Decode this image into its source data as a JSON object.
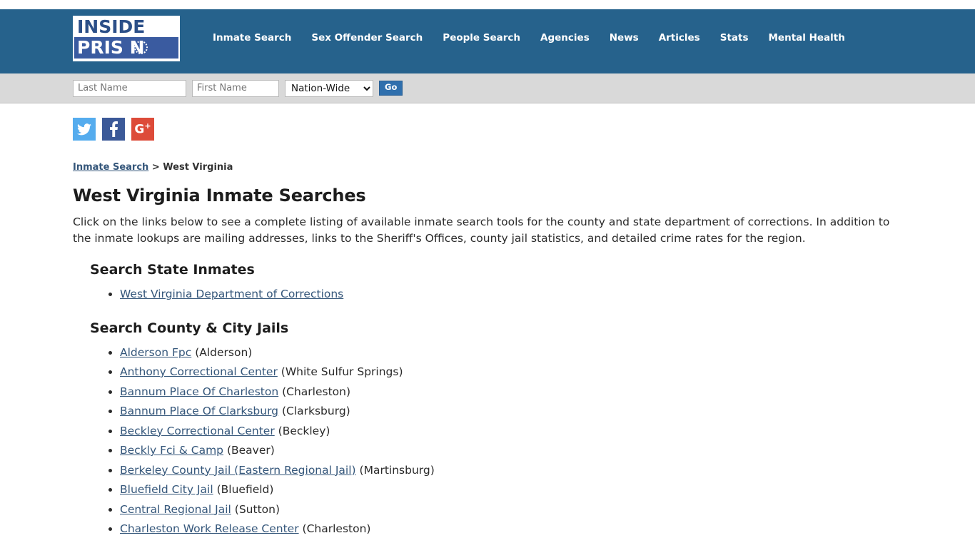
{
  "brand": {
    "logo_line1": "INSIDE",
    "logo_line2": "PRIS N",
    "ring_icon": "barbed-wire-circle-icon"
  },
  "colors": {
    "header_blue": "#26628c",
    "searchbar_gray": "#d9d9d9",
    "link_blue": "#34567a",
    "go_button_blue": "#2f6fad",
    "twitter": "#55acee",
    "facebook": "#3b5998",
    "googleplus": "#dd4b39"
  },
  "nav": {
    "items": [
      {
        "label": "Inmate Search"
      },
      {
        "label": "Sex Offender Search"
      },
      {
        "label": "People Search"
      },
      {
        "label": "Agencies"
      },
      {
        "label": "News"
      },
      {
        "label": "Articles"
      },
      {
        "label": "Stats"
      },
      {
        "label": "Mental Health"
      }
    ]
  },
  "search": {
    "last_name_placeholder": "Last Name",
    "last_name_value": "",
    "first_name_placeholder": "First Name",
    "first_name_value": "",
    "scope_selected": "Nation-Wide",
    "scope_options": [
      "Nation-Wide"
    ],
    "go_label": "Go"
  },
  "social": {
    "twitter_label": "Twitter",
    "facebook_label": "Facebook",
    "googleplus_label": "G",
    "googleplus_plus": "+"
  },
  "breadcrumb": {
    "parent": "Inmate Search",
    "separator": ">",
    "current": "West Virginia"
  },
  "page": {
    "title": "West Virginia Inmate Searches",
    "intro": "Click on the links below to see a complete listing of available inmate search tools for the county and state department of corrections. In addition to the inmate lookups are mailing addresses, links to the Sheriff's Offices, county jail statistics, and detailed crime rates for the region."
  },
  "state_section": {
    "heading": "Search State Inmates",
    "items": [
      {
        "name": "West Virginia Department of Corrections",
        "city": ""
      }
    ]
  },
  "county_section": {
    "heading": "Search County & City Jails",
    "items": [
      {
        "name": "Alderson Fpc",
        "city": "(Alderson)"
      },
      {
        "name": "Anthony Correctional Center",
        "city": "(White Sulfur Springs)"
      },
      {
        "name": "Bannum Place Of Charleston",
        "city": "(Charleston)"
      },
      {
        "name": "Bannum Place Of Clarksburg",
        "city": "(Clarksburg)"
      },
      {
        "name": "Beckley Correctional Center",
        "city": "(Beckley)"
      },
      {
        "name": "Beckly Fci & Camp",
        "city": "(Beaver)"
      },
      {
        "name": "Berkeley County Jail (Eastern Regional Jail)",
        "city": "(Martinsburg)"
      },
      {
        "name": "Bluefield City Jail",
        "city": "(Bluefield)"
      },
      {
        "name": "Central Regional Jail",
        "city": "(Sutton)"
      },
      {
        "name": "Charleston Work Release Center",
        "city": "(Charleston)"
      }
    ]
  }
}
